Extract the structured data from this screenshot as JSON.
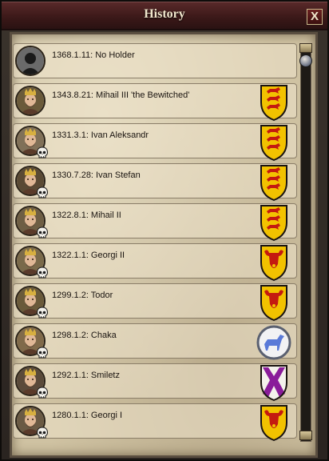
{
  "window": {
    "title": "History",
    "close_label": "X"
  },
  "entries": [
    {
      "text": "1368.1.11: No Holder",
      "portrait": "silhouette",
      "dead": false,
      "arms": "none"
    },
    {
      "text": "1343.8.21: Mihail III 'the Bewitched'",
      "portrait": "ruler",
      "dead": false,
      "arms": "gold-red-lions"
    },
    {
      "text": "1331.3.1: Ivan Aleksandr",
      "portrait": "ruler",
      "dead": true,
      "arms": "gold-red-lions"
    },
    {
      "text": "1330.7.28: Ivan Stefan",
      "portrait": "ruler",
      "dead": true,
      "arms": "gold-red-lions"
    },
    {
      "text": "1322.8.1: Mihail II",
      "portrait": "ruler",
      "dead": true,
      "arms": "gold-red-lions"
    },
    {
      "text": "1322.1.1: Georgi II",
      "portrait": "ruler",
      "dead": true,
      "arms": "gold-red-bull"
    },
    {
      "text": "1299.1.2: Todor",
      "portrait": "ruler",
      "dead": true,
      "arms": "gold-red-bull"
    },
    {
      "text": "1298.1.2: Chaka",
      "portrait": "ruler",
      "dead": true,
      "arms": "white-blue-horse"
    },
    {
      "text": "1292.1.1: Smiletz",
      "portrait": "ruler",
      "dead": true,
      "arms": "white-purple-saltire"
    },
    {
      "text": "1280.1.1: Georgi I",
      "portrait": "ruler",
      "dead": true,
      "arms": "gold-red-bull"
    }
  ],
  "colors": {
    "title_bar": "#5a2a2a",
    "parchment": "#cfc2a2",
    "shield_gold": "#f2c200",
    "shield_red": "#c41a10",
    "horse_blue": "#5a7ad8",
    "saltire_purple": "#8a1c9a"
  }
}
